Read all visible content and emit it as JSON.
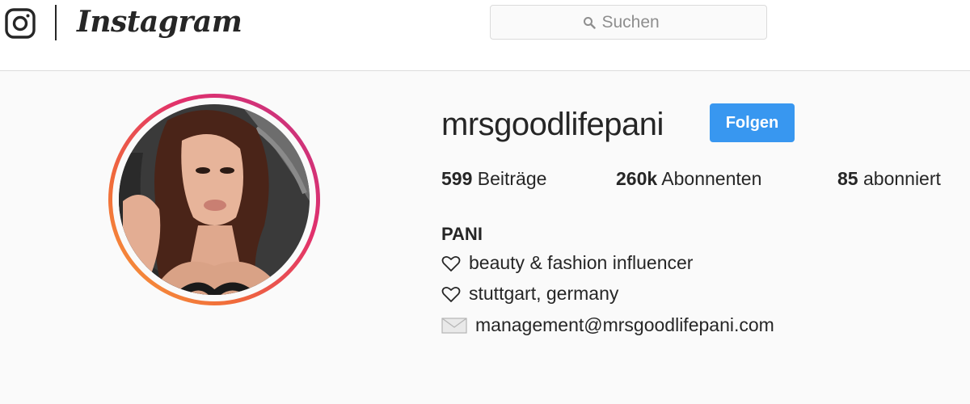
{
  "header": {
    "wordmark": "Instagram",
    "search_placeholder": "Suchen"
  },
  "profile": {
    "username": "mrsgoodlifepani",
    "follow_label": "Folgen",
    "stats": {
      "posts_count": "599",
      "posts_label": "Beiträge",
      "followers_count": "260k",
      "followers_label": "Abonnenten",
      "following_count": "85",
      "following_label": "abonniert"
    },
    "full_name": "PANI",
    "bio": [
      {
        "icon": "heart-outline-icon",
        "text": "beauty & fashion influencer"
      },
      {
        "icon": "heart-outline-icon",
        "text": "stuttgart, germany"
      },
      {
        "icon": "envelope-icon",
        "text": "management@mrsgoodlifepani.com"
      }
    ]
  },
  "colors": {
    "follow_button": "#3897f0",
    "story_ring_start": "#f9a03a",
    "story_ring_end": "#c13584",
    "page_background": "#fafafa",
    "text": "#262626"
  }
}
